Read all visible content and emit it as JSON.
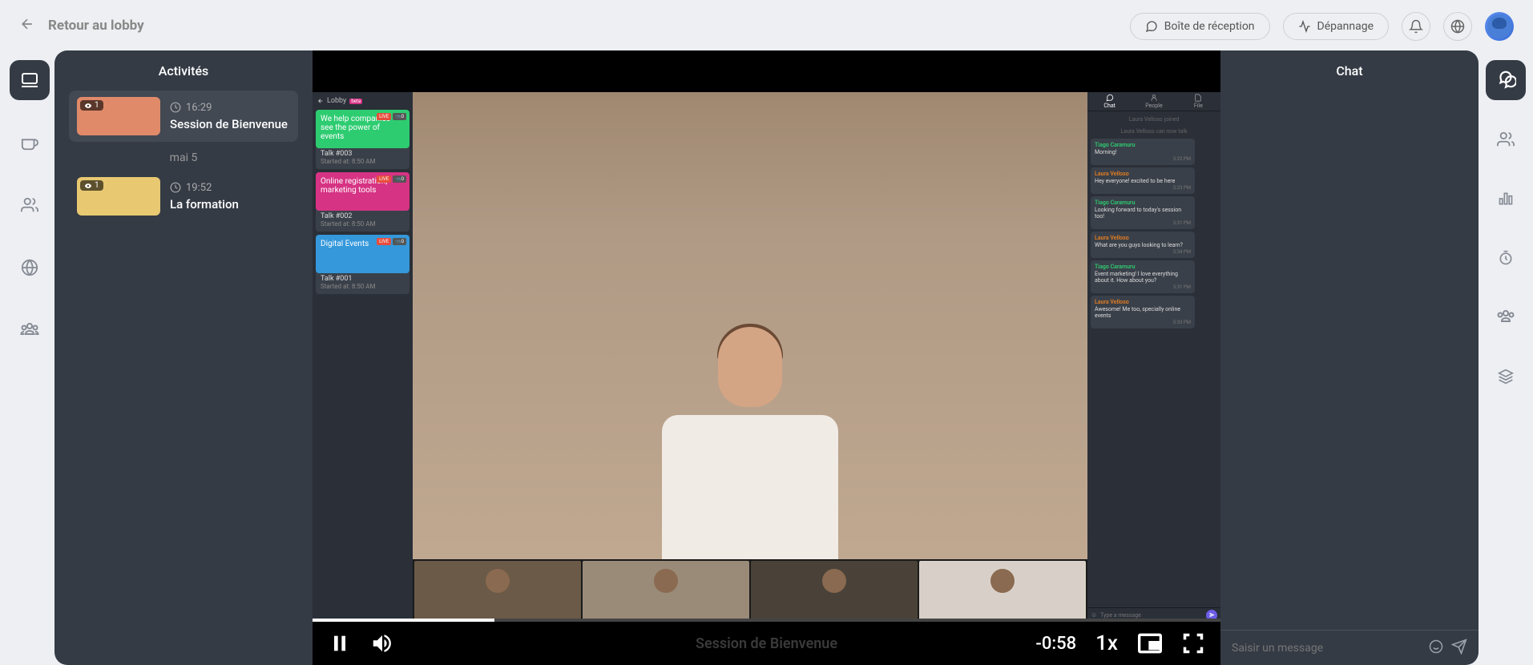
{
  "header": {
    "back_label": "Retour au lobby",
    "inbox_label": "Boîte de réception",
    "troubleshoot_label": "Dépannage"
  },
  "activities": {
    "title": "Activités",
    "items": [
      {
        "viewers": "1",
        "time": "16:29",
        "title": "Session de Bienvenue",
        "color": "#e08a6a"
      },
      {
        "viewers": "1",
        "time": "19:52",
        "title": "La formation",
        "color": "#e8c972"
      }
    ],
    "date_divider": "mai 5"
  },
  "video": {
    "lobby_label": "Lobby",
    "beta_label": "beta",
    "remaining_time": "-0:58",
    "speed": "1x",
    "embedded_sidebar": {
      "cards": [
        {
          "bg": "#2ecc71",
          "text": "We help companies see the power of events",
          "talk": "Talk #003",
          "started": "Started at: 8:50 AM"
        },
        {
          "bg": "#d63384",
          "text": "Online registration, marketing tools",
          "talk": "Talk #002",
          "started": "Started at: 8:50 AM"
        },
        {
          "bg": "#3498db",
          "text": "Digital Events",
          "talk": "Talk #001",
          "started": "Started at: 8:50 AM"
        }
      ]
    },
    "embedded_tabs": {
      "chat": "Chat",
      "people": "People",
      "file": "File"
    },
    "embedded_messages": {
      "sys1": "Laura Velloso joined",
      "sys2": "Laura Velloso can now talk",
      "msgs": [
        {
          "name": "Tiago Caramuru",
          "cl": "c1",
          "text": "Morning!",
          "ts": "5:22 PM"
        },
        {
          "name": "Laura Velloso",
          "cl": "c2",
          "text": "Hey everyone! excited to be here",
          "ts": "5:23 PM"
        },
        {
          "name": "Tiago Caramuru",
          "cl": "c1",
          "text": "Looking forward to today's session too!",
          "ts": "5:31 PM"
        },
        {
          "name": "Laura Velloso",
          "cl": "c2",
          "text": "What are you guys looking to learn?",
          "ts": "5:34 PM"
        },
        {
          "name": "Tiago Caramuru",
          "cl": "c1",
          "text": "Event marketing! I love everything about it. How about you?",
          "ts": "5:31 PM"
        },
        {
          "name": "Laura Velloso",
          "cl": "c2",
          "text": "Awesome! Me too, specially online events",
          "ts": "5:33 PM"
        }
      ],
      "input_placeholder": "Type a message"
    }
  },
  "chat": {
    "title": "Chat",
    "input_placeholder": "Saisir un message"
  },
  "session_title": "Session de Bienvenue",
  "live_badge": "LIVE"
}
